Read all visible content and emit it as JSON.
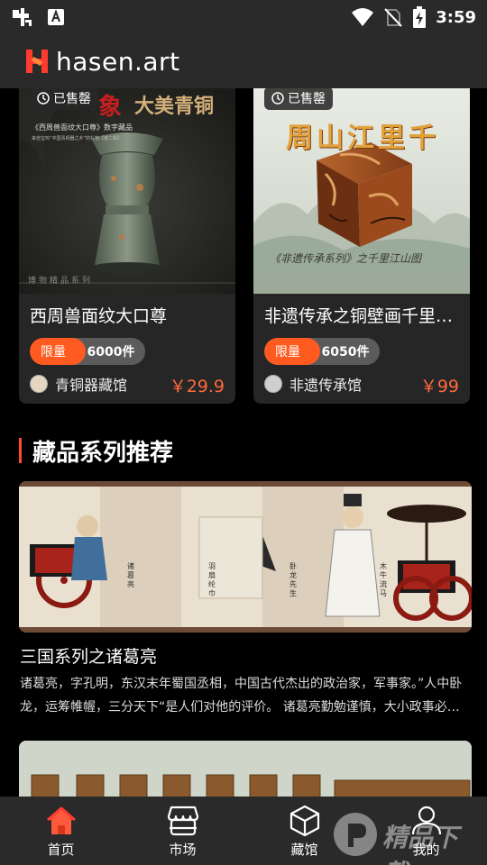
{
  "status_bar": {
    "time": "3:59",
    "icons": [
      "bug-icon",
      "notification-a-icon",
      "wifi-icon",
      "no-sim-icon",
      "battery-charging-icon"
    ]
  },
  "header": {
    "logo_text": "hasen.art",
    "brand_color": "#ff3b2f"
  },
  "products": [
    {
      "sold_label": "已售罄",
      "title": "西周兽面纹大口尊",
      "limit_label": "限量",
      "limit_count": "6000件",
      "owner": "青铜器藏馆",
      "price": "￥29.9",
      "image_text": {
        "headline_a": "象",
        "headline_b": "大美青铜",
        "caption_1": "《西周兽面纹大口尊》数字藏品",
        "caption_2": "来自宝鸡“中国青铜器之乡”的礼物【第二辑】",
        "series_note": "博物精品系列"
      }
    },
    {
      "sold_label": "已售罄",
      "title": "非遗传承之铜壁画千里江山图",
      "limit_label": "限量",
      "limit_count": "6050件",
      "owner": "非遗传承馆",
      "price": "￥99",
      "image_text": {
        "headline": "周山江里千",
        "caption": "《非遗传承系列》之千里江山图"
      }
    }
  ],
  "section": {
    "title": "藏品系列推荐"
  },
  "series": {
    "banner_labels": [
      "诸葛亮",
      "羽扇纶巾",
      "卧龙先生",
      "木牛流马"
    ],
    "title": "三国系列之诸葛亮",
    "description": "诸葛亮，字孔明，东汉末年蜀国丞相，中国古代杰出的政治家，军事家。”人中卧龙，运筹帷幄，三分天下“是人们对他的评价。 诸葛亮勤勉谨慎，大小政事必亲自处理"
  },
  "bottom_nav": {
    "items": [
      {
        "label": "首页",
        "icon": "home-icon",
        "active": true
      },
      {
        "label": "市场",
        "icon": "market-icon",
        "active": false
      },
      {
        "label": "藏馆",
        "icon": "cube-icon",
        "active": false
      },
      {
        "label": "我的",
        "icon": "profile-icon",
        "active": false
      }
    ],
    "active_color": "#ff5a3c"
  },
  "watermark": {
    "text": "精品下载"
  }
}
